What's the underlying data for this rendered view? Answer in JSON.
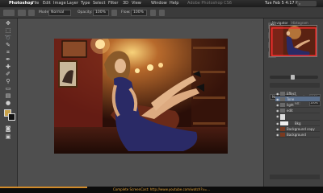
{
  "menubar": {
    "apple": "",
    "app": "Photoshop",
    "items": [
      "File",
      "Edit",
      "Image",
      "Layer",
      "Type",
      "Select",
      "Filter",
      "3D",
      "View",
      "Window",
      "Help"
    ],
    "window_title": "Adobe Photoshop CS6",
    "clock": "Tue Feb 5 4:17 PM"
  },
  "options": {
    "mode_label": "Mode:",
    "mode_value": "Normal",
    "opacity_label": "Opacity:",
    "opacity_value": "100%",
    "flow_label": "Flow:",
    "flow_value": "100%"
  },
  "panels": {
    "tabs": [
      "Navigator",
      "Histogram"
    ],
    "blend_mode": "Normal",
    "opacity_label": "Opacity:",
    "opacity_value": "100%",
    "fill_label": "Fill:",
    "fill_value": "100%",
    "layers": [
      "Effect",
      "Tone",
      "light",
      "edit",
      "",
      "Bkg",
      "Background copy",
      "Background"
    ]
  },
  "statusbar": {
    "url": "Complete ScreenCast: http://www.youtube.com/watch?v=...",
    "progress": 0.27
  },
  "colors": {
    "foreground": "#c8a24a",
    "background": "#111111",
    "progress": "#d08a2a"
  }
}
